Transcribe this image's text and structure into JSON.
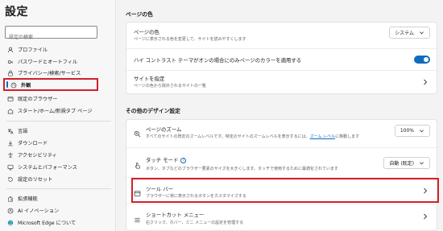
{
  "app": {
    "title": "設定"
  },
  "search": {
    "placeholder": "設定の検索"
  },
  "sidebar": {
    "items": [
      {
        "label": "プロファイル",
        "icon": "profile-icon"
      },
      {
        "label": "パスワードとオートフィル",
        "icon": "key-icon"
      },
      {
        "label": "プライバシー/検索/サービス",
        "icon": "lock-icon"
      },
      {
        "label": "外観",
        "icon": "appearance-icon",
        "active": true
      },
      {
        "label": "既定のブラウザー",
        "icon": "browser-icon"
      },
      {
        "label": "スタート/ホーム/新規タブ ページ",
        "icon": "home-icon"
      },
      {
        "label": "言語",
        "icon": "language-icon"
      },
      {
        "label": "ダウンロード",
        "icon": "download-icon"
      },
      {
        "label": "アクセシビリティ",
        "icon": "accessibility-icon"
      },
      {
        "label": "システムとパフォーマンス",
        "icon": "system-icon"
      },
      {
        "label": "設定のリセット",
        "icon": "reset-icon"
      },
      {
        "label": "拡張機能",
        "icon": "extensions-icon"
      },
      {
        "label": "AI イノベーション",
        "icon": "ai-icon"
      },
      {
        "label": "Microsoft Edge について",
        "icon": "edge-icon"
      }
    ]
  },
  "page_color": {
    "section_title": "ページの色",
    "theme": {
      "title": "ページの色",
      "desc": "ページに表示される色を変更して、サイトを読みやすくします",
      "value": "システム"
    },
    "contrast": {
      "title": "ハイ コントラスト テーマがオンの場合にのみページのカラーを適用する",
      "enabled": true
    },
    "site": {
      "title": "サイトを指定",
      "desc": "ページの色から除外されるサイトの一覧"
    }
  },
  "other_design": {
    "section_title": "その他のデザイン設定",
    "zoom": {
      "title": "ページのズーム",
      "desc_prefix": "すべてのサイトの既定のズームレベルです。特定のサイトのズームレベルを表示するには、",
      "desc_link": "ズーム レベル",
      "desc_suffix": "に移動します",
      "value": "100%"
    },
    "touch": {
      "title": "タッチ モード",
      "help": "?",
      "desc": "ボタン、タブなどのブラウザー要素のサイズを大きくします。タッチで使用するために最適化されています",
      "value": "自動 (既定)"
    },
    "toolbar": {
      "title": "ツール バー",
      "desc": "ブラウザーに常に表示されるボタンをカスタマイズする"
    },
    "shortcut": {
      "title": "ショートカット メニュー",
      "desc": "右クリック、ホバー、ミニ メニューの設定を管理する"
    }
  },
  "colors": {
    "accent": "#0f6cbd",
    "highlight": "#d3202a"
  }
}
